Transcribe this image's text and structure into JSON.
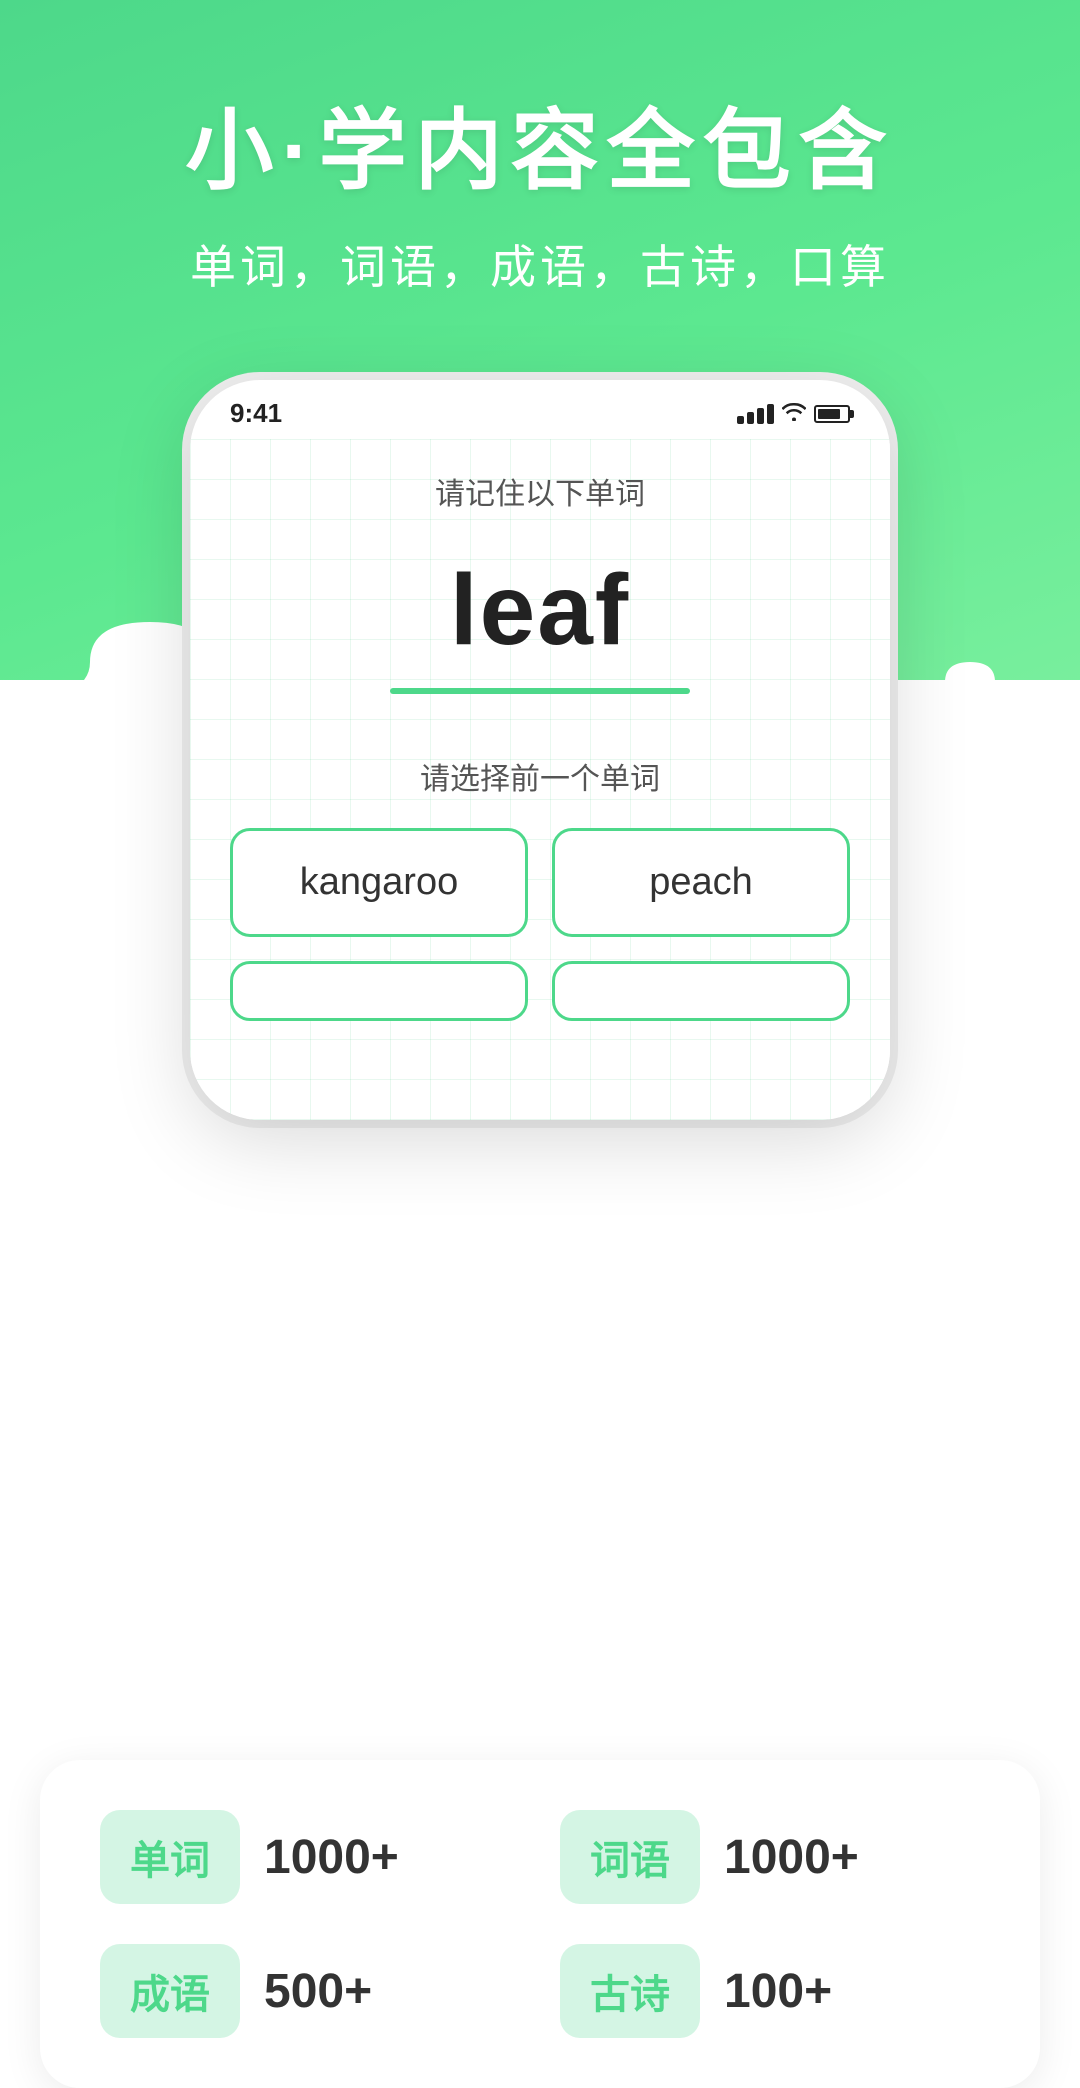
{
  "header": {
    "main_title": "小·学内容全包含",
    "subtitle": "单词，词语，成语，古诗，口算"
  },
  "phone": {
    "status_bar": {
      "time": "9:41"
    },
    "instruction": "请记住以下单词",
    "word": "leaf",
    "choose_prompt": "请选择前一个单词",
    "answers": [
      {
        "text": "kangaroo"
      },
      {
        "text": "peach"
      }
    ]
  },
  "stats": {
    "items": [
      {
        "tag": "单词",
        "count": "1000+"
      },
      {
        "tag": "词语",
        "count": "1000+"
      },
      {
        "tag": "成语",
        "count": "500+"
      },
      {
        "tag": "古诗",
        "count": "100+"
      }
    ]
  }
}
